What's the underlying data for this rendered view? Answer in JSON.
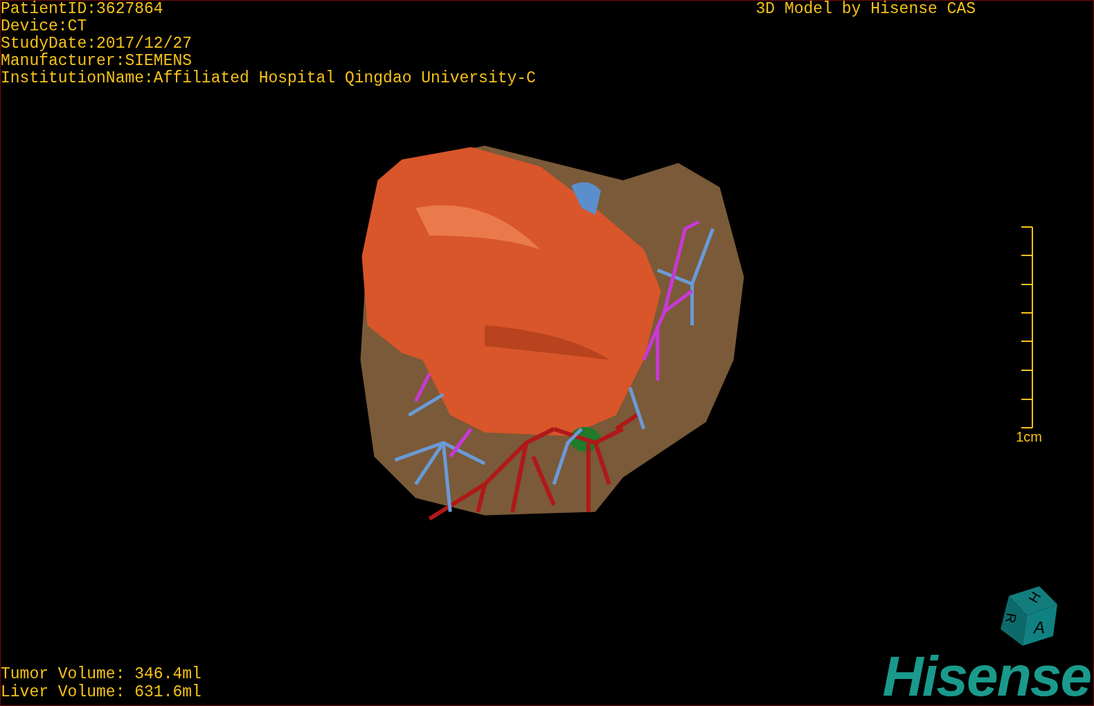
{
  "study_info": [
    "PatientID:3627864",
    "Device:CT",
    "StudyDate:2017/12/27",
    "Manufacturer:SIEMENS",
    "InstitutionName:Affiliated Hospital Qingdao University-C"
  ],
  "model_credit": "3D Model by Hisense CAS",
  "viewport": {
    "kind": "picture"
  },
  "scale_bar": {
    "label": "1cm"
  },
  "orientation_cube": {
    "faces": [
      "H",
      "R",
      "A"
    ]
  },
  "volumes": [
    "Tumor Volume: 346.4ml",
    "Liver Volume: 631.6ml"
  ],
  "logo": "Hisense"
}
